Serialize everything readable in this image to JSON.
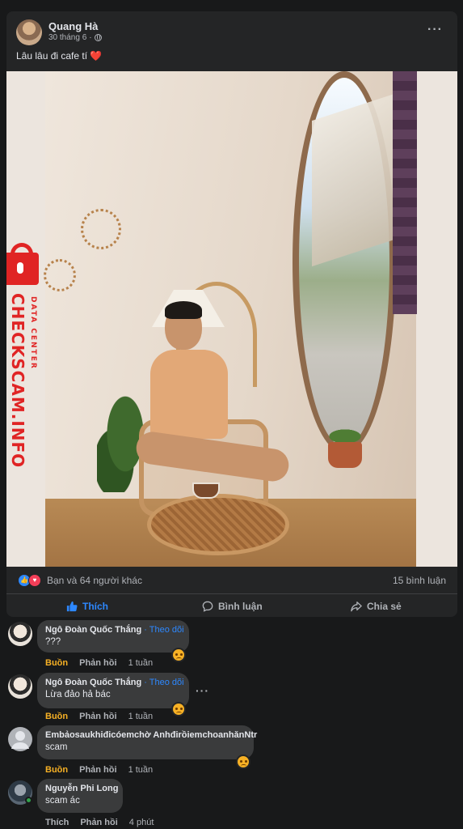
{
  "post": {
    "author": "Quang Hà",
    "date": "30 tháng 6",
    "dot": "·",
    "more": "···",
    "caption": "Lâu lâu đi cafe tí ❤️",
    "watermark": {
      "big": "CHECKSCAM.INFO",
      "small": "DATA CENTER"
    },
    "reactions_text": "Bạn và 64 người khác",
    "comments_count": "15 bình luận",
    "actions": {
      "like": "Thích",
      "comment": "Bình luận",
      "share": "Chia sẻ"
    }
  },
  "comments": [
    {
      "name": "Ngô Đoàn Quốc Thắng",
      "follow": "· Theo dõi",
      "text": "???",
      "reaction": "Buồn",
      "reply": "Phản hồi",
      "time": "1 tuần"
    },
    {
      "name": "Ngô Đoàn Quốc Thắng",
      "follow": "· Theo dõi",
      "text": "Lừa đảo hả bác",
      "reaction": "Buồn",
      "reply": "Phản hồi",
      "time": "1 tuần",
      "more": "···"
    },
    {
      "name": "Embảosaukhiđicóemchờ AnhđirồiemchoanhănNtr",
      "text": "scam",
      "reaction": "Buồn",
      "reply": "Phản hồi",
      "time": "1 tuần"
    },
    {
      "name": "Nguyễn Phi Long",
      "text": "scam ác",
      "reaction": "Thích",
      "reply": "Phản hồi",
      "time": "4 phút"
    }
  ]
}
